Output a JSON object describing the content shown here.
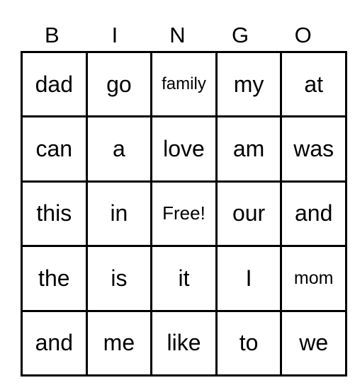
{
  "header": [
    "B",
    "I",
    "N",
    "G",
    "O"
  ],
  "rows": [
    [
      "dad",
      "go",
      "family",
      "my",
      "at"
    ],
    [
      "can",
      "a",
      "love",
      "am",
      "was"
    ],
    [
      "this",
      "in",
      "Free!",
      "our",
      "and"
    ],
    [
      "the",
      "is",
      "it",
      "I",
      "mom"
    ],
    [
      "and",
      "me",
      "like",
      "to",
      "we"
    ]
  ]
}
